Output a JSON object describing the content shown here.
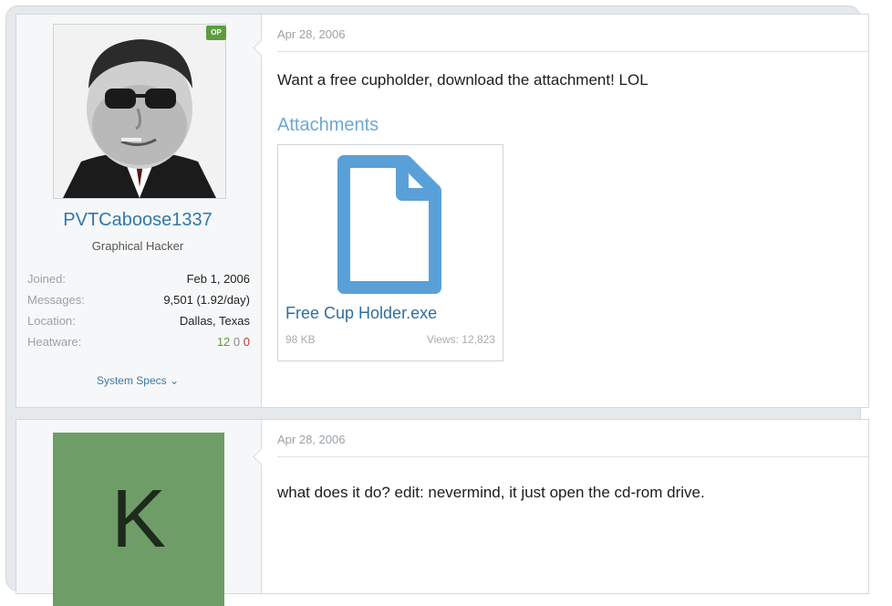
{
  "posts": [
    {
      "user": {
        "badge": "OP",
        "name": "PVTCaboose1337",
        "title": "Graphical Hacker",
        "stats": [
          {
            "label": "Joined:",
            "value": "Feb 1, 2006"
          },
          {
            "label": "Messages:",
            "value": "9,501 (1.92/day)"
          },
          {
            "label": "Location:",
            "value": "Dallas, Texas"
          }
        ],
        "heatware_label": "Heatware:",
        "heatware_pos": "12",
        "heatware_neu": "0",
        "heatware_neg": "0",
        "system_specs": "System Specs ⌄"
      },
      "date": "Apr 28, 2006",
      "message": "Want a free cupholder, download the attachment! LOL",
      "attachments_label": "Attachments",
      "attachment": {
        "filename": "Free Cup Holder.exe",
        "size": "98 KB",
        "views": "Views: 12,823",
        "icon": "file-icon"
      }
    },
    {
      "user": {
        "avatar_letter": "K"
      },
      "date": "Apr 28, 2006",
      "message": "what does it do? edit: nevermind, it just open the cd-rom drive."
    }
  ],
  "colors": {
    "link_blue": "#2f78ab",
    "attachment_blue": "#5aa0d8",
    "heatware_green": "#5b9b3a",
    "avatar_k_green": "#6f9d68"
  }
}
